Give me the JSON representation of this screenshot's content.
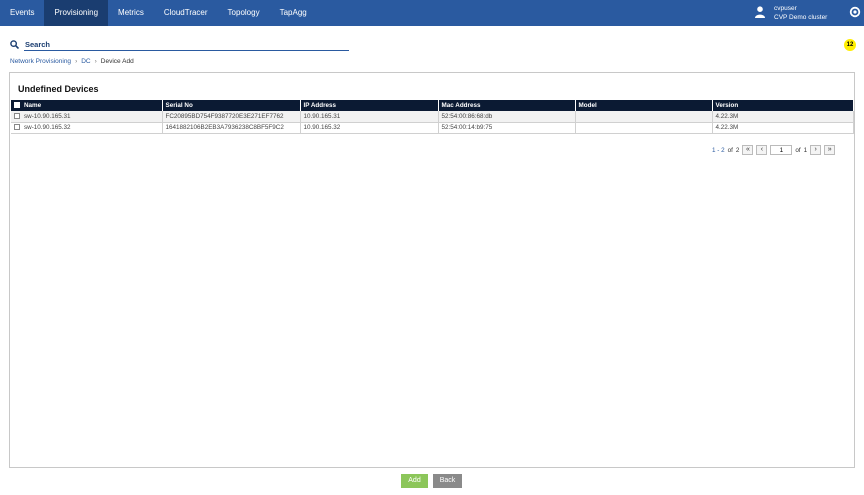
{
  "nav": {
    "items": [
      {
        "label": "Events"
      },
      {
        "label": "Provisioning",
        "active": true
      },
      {
        "label": "Metrics"
      },
      {
        "label": "CloudTracer"
      },
      {
        "label": "Topology"
      },
      {
        "label": "TapAgg"
      }
    ]
  },
  "user": {
    "name": "cvpuser",
    "cluster": "CVP Demo cluster",
    "icon": "user-icon"
  },
  "settings_icon": "gear-icon",
  "search": {
    "placeholder": "Search",
    "value": "",
    "icon": "search-icon"
  },
  "notification_count": "12",
  "breadcrumb": {
    "items": [
      "Network Provisioning",
      "DC"
    ],
    "current": "Device Add"
  },
  "panel": {
    "title": "Undefined Devices"
  },
  "table": {
    "columns": [
      "Name",
      "Serial No",
      "IP Address",
      "Mac Address",
      "Model",
      "Version"
    ],
    "rows": [
      {
        "name": "sw-10.90.165.31",
        "serial": "FC20895BD754F9387720E3E271EF7762",
        "ip": "10.90.165.31",
        "mac": "52:54:00:86:68:db",
        "model": "",
        "version": "4.22.3M"
      },
      {
        "name": "sw-10.90.165.32",
        "serial": "1641882106B2EB3A7936238C8BF5F9C2",
        "ip": "10.90.165.32",
        "mac": "52:54:00:14:b9:75",
        "model": "",
        "version": "4.22.3M"
      }
    ]
  },
  "pager": {
    "range": "1 - 2",
    "of_label": "of",
    "total": "2",
    "page": "1",
    "page_of_label": "of",
    "pages": "1"
  },
  "actions": {
    "add_label": "Add",
    "back_label": "Back"
  },
  "colors": {
    "topbar": "#2a5aa0",
    "nav_active": "#1a3d70",
    "table_header": "#0b1a33",
    "add_button": "#8cc65a",
    "back_button": "#8a8a8a",
    "badge": "#ffee00"
  }
}
